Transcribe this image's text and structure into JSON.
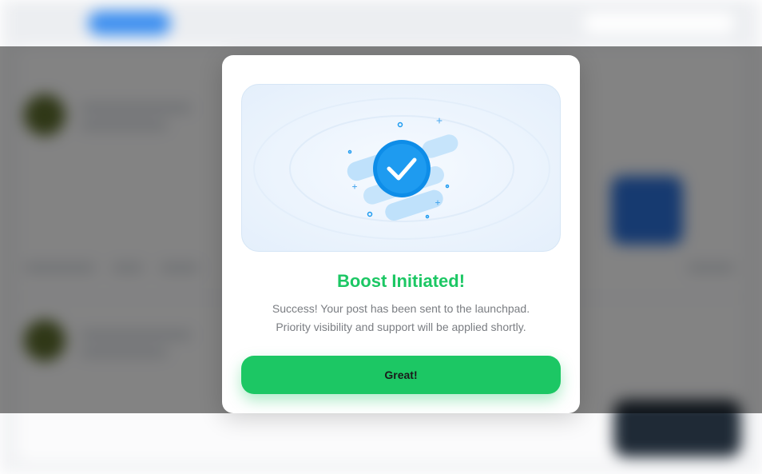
{
  "modal": {
    "title": "Boost Initiated!",
    "message_line1": "Success! Your post has been sent to the launchpad.",
    "message_line2": "Priority visibility and support will be applied shortly.",
    "button_label": "Great!",
    "icon": "check-circle-icon"
  },
  "colors": {
    "accent_green": "#1cc764",
    "check_blue": "#1e9bf0",
    "overlay": "rgba(0,0,0,0.48)"
  }
}
